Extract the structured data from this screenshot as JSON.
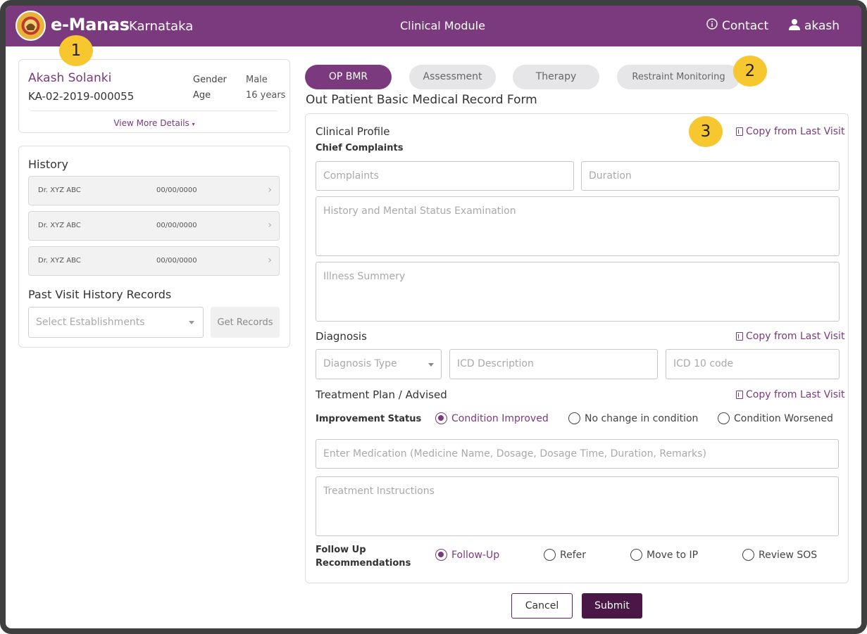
{
  "header": {
    "brand": "e-Manas",
    "brand_sub": "Karnataka",
    "module": "Clinical Module",
    "contact_label": "Contact",
    "user_label": "akash",
    "color": "#7b3a7d"
  },
  "patient": {
    "name": "Akash Solanki",
    "id": "KA-02-2019-000055",
    "gender_label": "Gender",
    "gender": "Male",
    "age_label": "Age",
    "age": "16 years",
    "more_details": "View More Details"
  },
  "history": {
    "title": "History",
    "rows": [
      {
        "doctor": "Dr. XYZ ABC",
        "date": "00/00/0000"
      },
      {
        "doctor": "Dr. XYZ ABC",
        "date": "00/00/0000"
      },
      {
        "doctor": "Dr. XYZ ABC",
        "date": "00/00/0000"
      }
    ],
    "past_title": "Past Visit History Records",
    "select_placeholder": "Select Establishments",
    "get_records": "Get Records"
  },
  "tabs": [
    {
      "label": "OP BMR",
      "active": true
    },
    {
      "label": "Assessment",
      "active": false
    },
    {
      "label": "Therapy",
      "active": false
    },
    {
      "label": "Restraint Monitoring",
      "active": false
    }
  ],
  "form": {
    "title": "Out Patient Basic Medical Record Form",
    "clinical_profile": "Clinical Profile",
    "chief_complaints": "Chief Complaints",
    "copy_last_visit": "Copy from Last Visit",
    "complaints_ph": "Complaints",
    "duration_ph": "Duration",
    "history_ph": "History and Mental Status Examination",
    "illness_ph": "Illness Summery",
    "diagnosis": "Diagnosis",
    "diagnosis_type_ph": "Diagnosis Type",
    "icd_desc_ph": "ICD Description",
    "icd_code_ph": "ICD 10 code",
    "treatment": "Treatment Plan / Advised",
    "improvement_label": "Improvement Status",
    "improvement_options": [
      "Condition Improved",
      "No change in condition",
      "Condition Worsened"
    ],
    "improvement_selected": "Condition Improved",
    "medication_ph": "Enter Medication (Medicine Name, Dosage, Dosage Time, Duration, Remarks)",
    "instructions_ph": "Treatment Instructions",
    "followup_label_1": "Follow Up",
    "followup_label_2": "Recommendations",
    "followup_options": [
      "Follow-Up",
      "Refer",
      "Move to IP",
      "Review SOS"
    ],
    "followup_selected": "Follow-Up"
  },
  "actions": {
    "cancel": "Cancel",
    "submit": "Submit"
  },
  "markers": [
    "1",
    "2",
    "3"
  ]
}
